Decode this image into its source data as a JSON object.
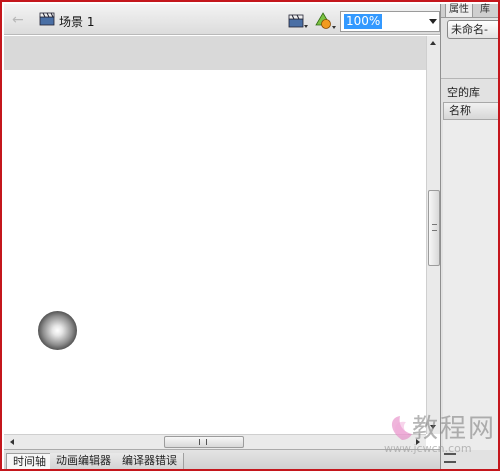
{
  "editbar": {
    "back_icon": "arrow-left-icon",
    "scene_icon": "clapperboard-icon",
    "scene_label": "场景 1",
    "edit_scene_icon": "clapperboard-dropdown-icon",
    "edit_symbol_icon": "shapes-dropdown-icon",
    "zoom_value": "100%"
  },
  "bottom_tabs": [
    {
      "label": "时间轴",
      "active": true
    },
    {
      "label": "动画编辑器",
      "active": false
    },
    {
      "label": "编译器错误",
      "active": false
    }
  ],
  "right_panel": {
    "tabs": [
      "属性",
      "库"
    ],
    "document_select": "未命名-",
    "status": "空的库",
    "column_name": "名称"
  },
  "watermark": {
    "text": "教程网",
    "url": "www.jcwcn.com"
  },
  "colors": {
    "frame": "#c4161c",
    "zoom_highlight": "#3399ff",
    "pasteboard": "#d9d9d9"
  }
}
